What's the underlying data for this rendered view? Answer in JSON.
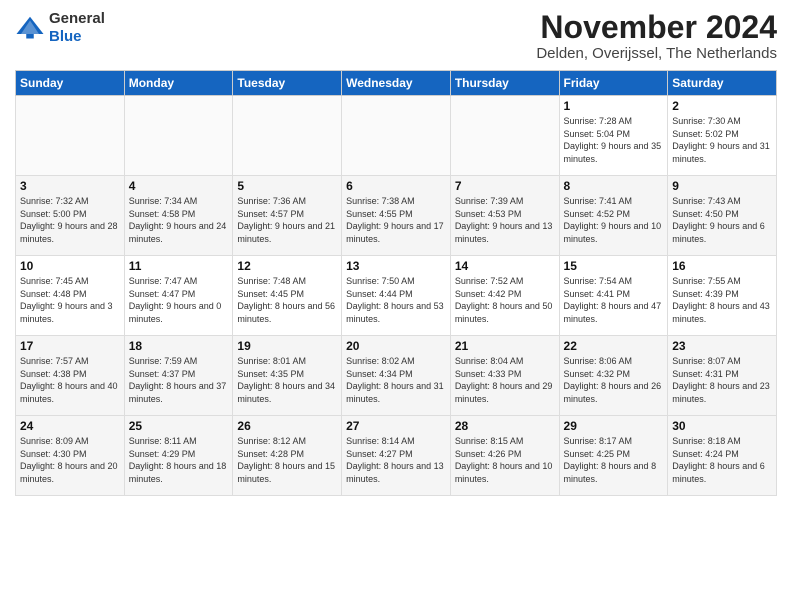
{
  "logo": {
    "line1": "General",
    "line2": "Blue"
  },
  "title": "November 2024",
  "subtitle": "Delden, Overijssel, The Netherlands",
  "headers": [
    "Sunday",
    "Monday",
    "Tuesday",
    "Wednesday",
    "Thursday",
    "Friday",
    "Saturday"
  ],
  "weeks": [
    [
      {
        "day": "",
        "info": ""
      },
      {
        "day": "",
        "info": ""
      },
      {
        "day": "",
        "info": ""
      },
      {
        "day": "",
        "info": ""
      },
      {
        "day": "",
        "info": ""
      },
      {
        "day": "1",
        "info": "Sunrise: 7:28 AM\nSunset: 5:04 PM\nDaylight: 9 hours and 35 minutes."
      },
      {
        "day": "2",
        "info": "Sunrise: 7:30 AM\nSunset: 5:02 PM\nDaylight: 9 hours and 31 minutes."
      }
    ],
    [
      {
        "day": "3",
        "info": "Sunrise: 7:32 AM\nSunset: 5:00 PM\nDaylight: 9 hours and 28 minutes."
      },
      {
        "day": "4",
        "info": "Sunrise: 7:34 AM\nSunset: 4:58 PM\nDaylight: 9 hours and 24 minutes."
      },
      {
        "day": "5",
        "info": "Sunrise: 7:36 AM\nSunset: 4:57 PM\nDaylight: 9 hours and 21 minutes."
      },
      {
        "day": "6",
        "info": "Sunrise: 7:38 AM\nSunset: 4:55 PM\nDaylight: 9 hours and 17 minutes."
      },
      {
        "day": "7",
        "info": "Sunrise: 7:39 AM\nSunset: 4:53 PM\nDaylight: 9 hours and 13 minutes."
      },
      {
        "day": "8",
        "info": "Sunrise: 7:41 AM\nSunset: 4:52 PM\nDaylight: 9 hours and 10 minutes."
      },
      {
        "day": "9",
        "info": "Sunrise: 7:43 AM\nSunset: 4:50 PM\nDaylight: 9 hours and 6 minutes."
      }
    ],
    [
      {
        "day": "10",
        "info": "Sunrise: 7:45 AM\nSunset: 4:48 PM\nDaylight: 9 hours and 3 minutes."
      },
      {
        "day": "11",
        "info": "Sunrise: 7:47 AM\nSunset: 4:47 PM\nDaylight: 9 hours and 0 minutes."
      },
      {
        "day": "12",
        "info": "Sunrise: 7:48 AM\nSunset: 4:45 PM\nDaylight: 8 hours and 56 minutes."
      },
      {
        "day": "13",
        "info": "Sunrise: 7:50 AM\nSunset: 4:44 PM\nDaylight: 8 hours and 53 minutes."
      },
      {
        "day": "14",
        "info": "Sunrise: 7:52 AM\nSunset: 4:42 PM\nDaylight: 8 hours and 50 minutes."
      },
      {
        "day": "15",
        "info": "Sunrise: 7:54 AM\nSunset: 4:41 PM\nDaylight: 8 hours and 47 minutes."
      },
      {
        "day": "16",
        "info": "Sunrise: 7:55 AM\nSunset: 4:39 PM\nDaylight: 8 hours and 43 minutes."
      }
    ],
    [
      {
        "day": "17",
        "info": "Sunrise: 7:57 AM\nSunset: 4:38 PM\nDaylight: 8 hours and 40 minutes."
      },
      {
        "day": "18",
        "info": "Sunrise: 7:59 AM\nSunset: 4:37 PM\nDaylight: 8 hours and 37 minutes."
      },
      {
        "day": "19",
        "info": "Sunrise: 8:01 AM\nSunset: 4:35 PM\nDaylight: 8 hours and 34 minutes."
      },
      {
        "day": "20",
        "info": "Sunrise: 8:02 AM\nSunset: 4:34 PM\nDaylight: 8 hours and 31 minutes."
      },
      {
        "day": "21",
        "info": "Sunrise: 8:04 AM\nSunset: 4:33 PM\nDaylight: 8 hours and 29 minutes."
      },
      {
        "day": "22",
        "info": "Sunrise: 8:06 AM\nSunset: 4:32 PM\nDaylight: 8 hours and 26 minutes."
      },
      {
        "day": "23",
        "info": "Sunrise: 8:07 AM\nSunset: 4:31 PM\nDaylight: 8 hours and 23 minutes."
      }
    ],
    [
      {
        "day": "24",
        "info": "Sunrise: 8:09 AM\nSunset: 4:30 PM\nDaylight: 8 hours and 20 minutes."
      },
      {
        "day": "25",
        "info": "Sunrise: 8:11 AM\nSunset: 4:29 PM\nDaylight: 8 hours and 18 minutes."
      },
      {
        "day": "26",
        "info": "Sunrise: 8:12 AM\nSunset: 4:28 PM\nDaylight: 8 hours and 15 minutes."
      },
      {
        "day": "27",
        "info": "Sunrise: 8:14 AM\nSunset: 4:27 PM\nDaylight: 8 hours and 13 minutes."
      },
      {
        "day": "28",
        "info": "Sunrise: 8:15 AM\nSunset: 4:26 PM\nDaylight: 8 hours and 10 minutes."
      },
      {
        "day": "29",
        "info": "Sunrise: 8:17 AM\nSunset: 4:25 PM\nDaylight: 8 hours and 8 minutes."
      },
      {
        "day": "30",
        "info": "Sunrise: 8:18 AM\nSunset: 4:24 PM\nDaylight: 8 hours and 6 minutes."
      }
    ]
  ]
}
